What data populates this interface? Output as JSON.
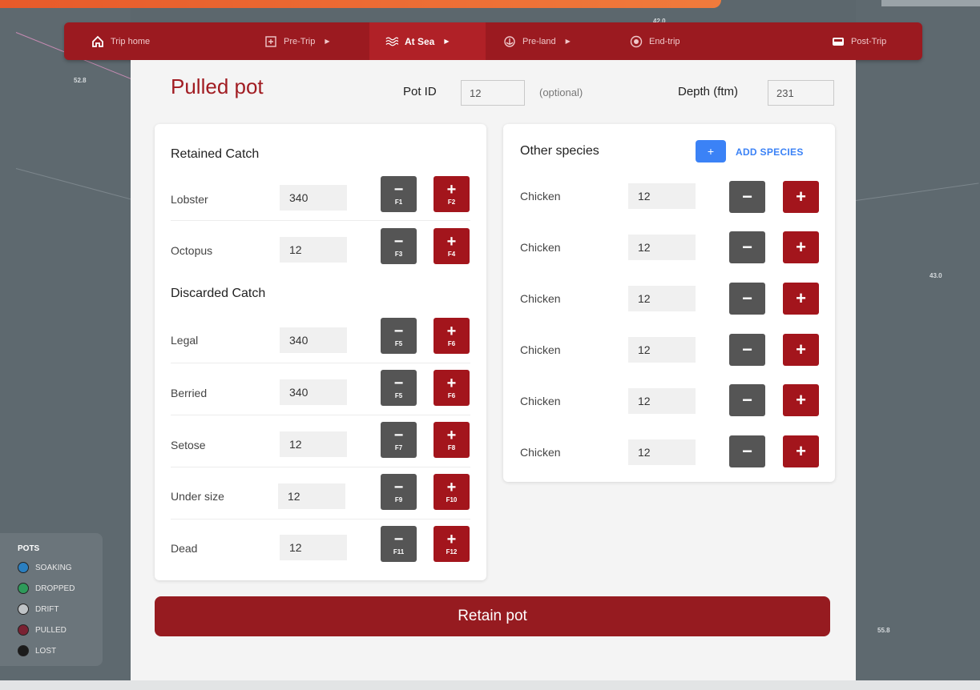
{
  "nav": {
    "items": [
      {
        "label": "Trip home",
        "icon": "home-icon"
      },
      {
        "label": "Pre-Trip",
        "icon": "checklist-icon"
      },
      {
        "label": "At Sea",
        "icon": "waves-icon"
      },
      {
        "label": "Pre-land",
        "icon": "anchor-icon"
      },
      {
        "label": "End-trip",
        "icon": "stop-icon"
      },
      {
        "label": "Post-Trip",
        "icon": "inbox-icon"
      }
    ],
    "active": "At Sea"
  },
  "form": {
    "title": "Pulled pot",
    "pot_id_label": "Pot ID",
    "pot_id_value": "12",
    "optional_label": "(optional)",
    "depth_label": "Depth (ftm)",
    "depth_value": "231"
  },
  "retained": {
    "heading": "Retained Catch",
    "rows": [
      {
        "label": "Lobster",
        "value": "340",
        "minus_key": "F1",
        "plus_key": "F2"
      },
      {
        "label": "Octopus",
        "value": "12",
        "minus_key": "F3",
        "plus_key": "F4"
      }
    ]
  },
  "discarded": {
    "heading": "Discarded Catch",
    "rows": [
      {
        "label": "Legal",
        "value": "340",
        "minus_key": "F5",
        "plus_key": "F6"
      },
      {
        "label": "Berried",
        "value": "340",
        "minus_key": "F5",
        "plus_key": "F6"
      },
      {
        "label": "Setose",
        "value": "12",
        "minus_key": "F7",
        "plus_key": "F8"
      },
      {
        "label": "Under size",
        "value": "12",
        "minus_key": "F9",
        "plus_key": "F10"
      },
      {
        "label": "Dead",
        "value": "12",
        "minus_key": "F11",
        "plus_key": "F12"
      }
    ]
  },
  "other": {
    "heading": "Other species",
    "add_label": "ADD SPECIES",
    "add_symbol": "+",
    "rows": [
      {
        "label": "Chicken",
        "value": "12"
      },
      {
        "label": "Chicken",
        "value": "12"
      },
      {
        "label": "Chicken",
        "value": "12"
      },
      {
        "label": "Chicken",
        "value": "12"
      },
      {
        "label": "Chicken",
        "value": "12"
      },
      {
        "label": "Chicken",
        "value": "12"
      }
    ]
  },
  "symbols": {
    "minus": "−",
    "plus": "+"
  },
  "retain_label": "Retain pot",
  "legend": {
    "title": "POTS",
    "items": [
      {
        "label": "SOAKING",
        "color": "#2b7fc0"
      },
      {
        "label": "DROPPED",
        "color": "#2e9a5a"
      },
      {
        "label": "DRIFT",
        "color": "#bfc3c6"
      },
      {
        "label": "PULLED",
        "color": "#7a2233"
      },
      {
        "label": "LOST",
        "color": "#1b1b1b"
      }
    ]
  },
  "map_labels": [
    "52.8",
    "43.0",
    "55.8",
    "42.0"
  ],
  "colors": {
    "brand": "#9b1a20",
    "accent": "#3b82f6"
  }
}
